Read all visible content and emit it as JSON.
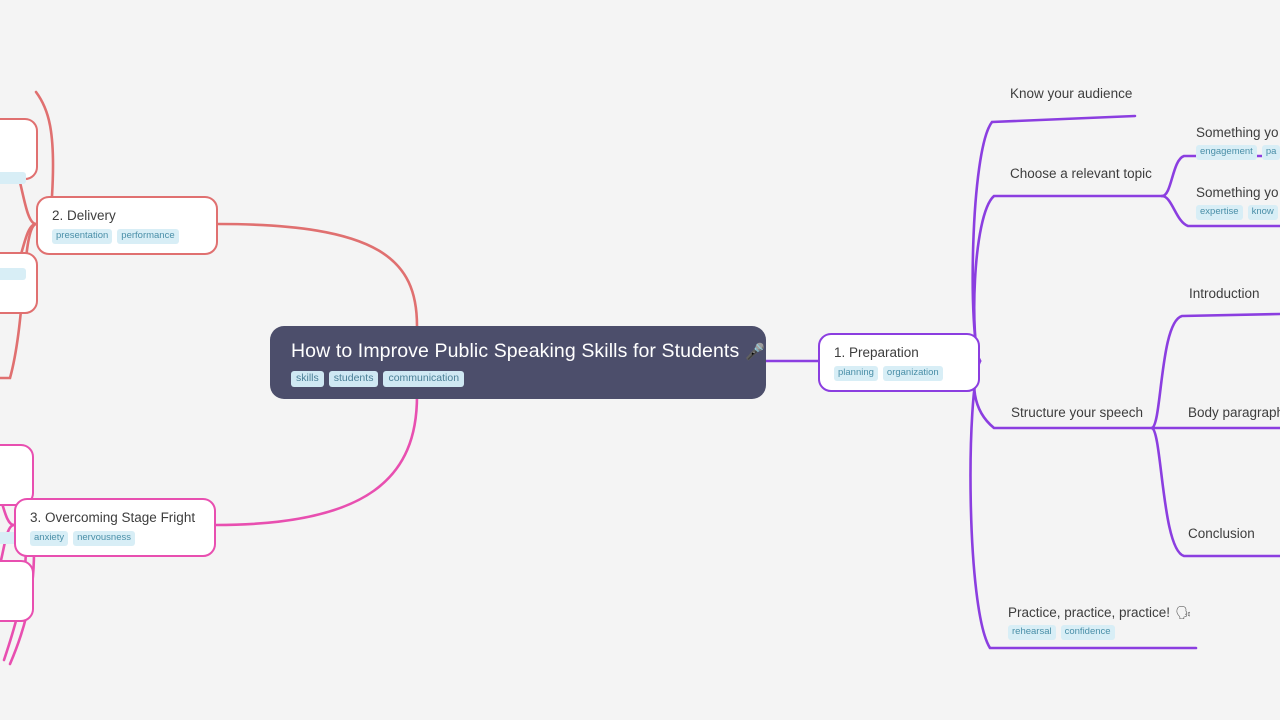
{
  "theme": {
    "background": "#f4f4f4",
    "root_fill": "#4c4e6b",
    "root_text": "#ffffff",
    "branch_purple": "#8b3ee0",
    "branch_salmon": "#e07070",
    "branch_pink": "#e84fb0",
    "node_fill": "#ffffff",
    "node_text": "#3d3d3d",
    "tag_fill": "#d8eef6",
    "tag_text": "#4a8fa8"
  },
  "root": {
    "title": "How to Improve Public Speaking Skills for Students",
    "emoji": "🎤",
    "emoji_name": "microphone-emoji",
    "tags": [
      "skills",
      "students",
      "communication"
    ]
  },
  "branches": {
    "preparation": {
      "title": "1. Preparation",
      "tags": [
        "planning",
        "organization"
      ],
      "color": "#8b3ee0"
    },
    "delivery": {
      "title": "2. Delivery",
      "tags": [
        "presentation",
        "performance"
      ],
      "color": "#e07070"
    },
    "stage_fright": {
      "title": "3. Overcoming Stage Fright",
      "tags": [
        "anxiety",
        "nervousness"
      ],
      "color": "#e84fb0"
    }
  },
  "preparation_children": [
    {
      "title": "Know your audience",
      "tags": []
    },
    {
      "title": "Choose a relevant topic",
      "tags": []
    },
    {
      "title": "Structure your speech",
      "tags": []
    },
    {
      "title": "Practice, practice, practice!",
      "emoji": "🗣",
      "emoji_name": "speaking-head-emoji",
      "tags": [
        "rehearsal",
        "confidence"
      ]
    }
  ],
  "topic_children": [
    {
      "title": "Something yo",
      "tags": [
        "engagement",
        "pa"
      ]
    },
    {
      "title": "Something yo",
      "tags": [
        "expertise",
        "know"
      ]
    }
  ],
  "structure_children": [
    {
      "title": "Introduction",
      "tags": []
    },
    {
      "title": "Body paragraph",
      "tags": []
    },
    {
      "title": "Conclusion",
      "tags": []
    }
  ]
}
